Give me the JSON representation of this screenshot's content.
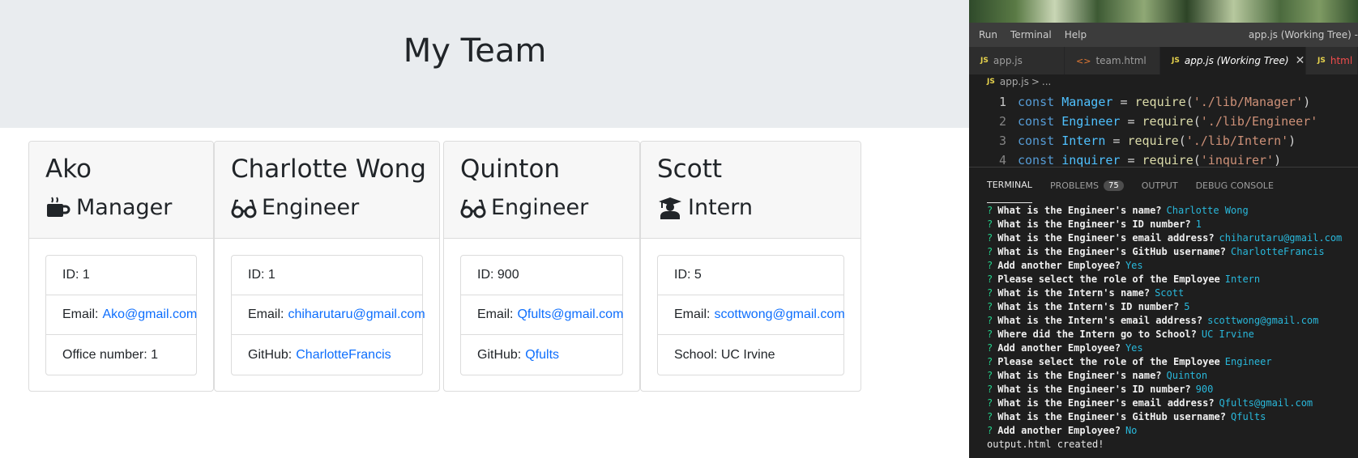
{
  "browser": {
    "title": "My Team",
    "cards": [
      {
        "name": "Ako",
        "role": "Manager",
        "icon": "coffee-mug-icon",
        "rows": [
          {
            "label": "ID: 1"
          },
          {
            "label": "Email:",
            "link": "Ako@gmail.com"
          },
          {
            "label": "Office number: 1"
          }
        ]
      },
      {
        "name": "Charlotte Wong",
        "role": "Engineer",
        "icon": "glasses-icon",
        "rows": [
          {
            "label": "ID: 1"
          },
          {
            "label": "Email:",
            "link": "chiharutaru@gmail.com"
          },
          {
            "label": "GitHub:",
            "link": "CharlotteFrancis"
          }
        ]
      },
      {
        "name": "Quinton",
        "role": "Engineer",
        "icon": "glasses-icon",
        "rows": [
          {
            "label": "ID: 900"
          },
          {
            "label": "Email:",
            "link": "Qfults@gmail.com"
          },
          {
            "label": "GitHub:",
            "link": "Qfults"
          }
        ]
      },
      {
        "name": "Scott",
        "role": "Intern",
        "icon": "graduate-icon",
        "rows": [
          {
            "label": "ID: 5"
          },
          {
            "label": "Email:",
            "link": "scottwong@gmail.com"
          },
          {
            "label": "School: UC Irvine"
          }
        ]
      }
    ]
  },
  "vscode": {
    "menu": [
      "Run",
      "Terminal",
      "Help"
    ],
    "window_title": "app.js (Working Tree) -",
    "tabs": [
      "app.js",
      "team.html",
      "app.js (Working Tree)",
      "html"
    ],
    "breadcrumb": [
      "app.js",
      ">",
      "..."
    ],
    "code": [
      {
        "n": "1",
        "kw": "const",
        "var": "Manager",
        "eq": "=",
        "fn": "require",
        "open": "(",
        "str": "'./lib/Manager'",
        "close": ")"
      },
      {
        "n": "2",
        "kw": "const",
        "var": "Engineer",
        "eq": "=",
        "fn": "require",
        "open": "(",
        "str": "'./lib/Engineer'",
        "close": ""
      },
      {
        "n": "3",
        "kw": "const",
        "var": "Intern",
        "eq": "=",
        "fn": "require",
        "open": "(",
        "str": "'./lib/Intern'",
        "close": ")"
      },
      {
        "n": "4",
        "kw": "const",
        "var": "inquirer",
        "eq": "=",
        "fn": "require",
        "open": "(",
        "str": "'inquirer'",
        "close": ")"
      }
    ],
    "panel_tabs": [
      "TERMINAL",
      "PROBLEMS",
      "OUTPUT",
      "DEBUG CONSOLE"
    ],
    "problems_count": "75",
    "terminal": [
      {
        "mark": "?",
        "q": "What is the Engineer's name?",
        "a": "Charlotte Wong"
      },
      {
        "mark": "?",
        "q": "What is the Engineer's ID number?",
        "a": "1"
      },
      {
        "mark": "?",
        "q": "What is the Engineer's email address?",
        "a": "chiharutaru@gmail.com"
      },
      {
        "mark": "?",
        "q": "What is the Engineer's GitHub username?",
        "a": "CharlotteFrancis"
      },
      {
        "mark": "?",
        "q": "Add another Employee?",
        "a": "Yes"
      },
      {
        "mark": "?",
        "q": "Please select the role of the Employee",
        "a": "Intern"
      },
      {
        "mark": "?",
        "q": "What is the Intern's name?",
        "a": "Scott"
      },
      {
        "mark": "?",
        "q": "What is the Intern's ID number?",
        "a": "5"
      },
      {
        "mark": "?",
        "q": "What is the Intern's email address?",
        "a": "scottwong@gmail.com"
      },
      {
        "mark": "?",
        "q": "Where did the Intern go to School?",
        "a": "UC Irvine"
      },
      {
        "mark": "?",
        "q": "Add another Employee?",
        "a": "Yes"
      },
      {
        "mark": "?",
        "q": "Please select the role of the Employee",
        "a": "Engineer"
      },
      {
        "mark": "?",
        "q": "What is the Engineer's name?",
        "a": "Quinton"
      },
      {
        "mark": "?",
        "q": "What is the Engineer's ID number?",
        "a": "900"
      },
      {
        "mark": "?",
        "q": "What is the Engineer's email address?",
        "a": "Qfults@gmail.com"
      },
      {
        "mark": "?",
        "q": "What is the Engineer's GitHub username?",
        "a": "Qfults"
      },
      {
        "mark": "?",
        "q": "Add another Employee?",
        "a": "No"
      },
      {
        "mark": "",
        "q": "output.html created!",
        "a": ""
      }
    ]
  }
}
